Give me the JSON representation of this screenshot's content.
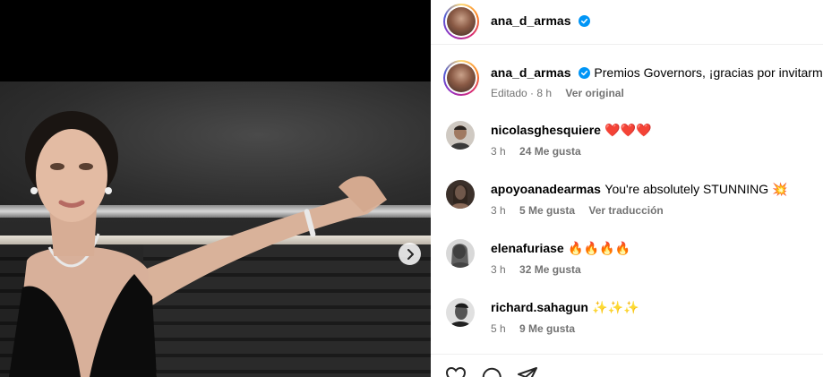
{
  "post": {
    "author": "ana_d_armas",
    "caption": "Premios Governors, ¡gracias por invitarme! ✨",
    "edited_label": "Editado",
    "age": "8 h",
    "translate_label": "Ver original"
  },
  "comments": [
    {
      "user": "nicolasghesquiere",
      "text": "❤️❤️❤️",
      "age": "3 h",
      "likes": "24 Me gusta",
      "extra": ""
    },
    {
      "user": "apoyoanadearmas",
      "text": "You're absolutely STUNNING 💥",
      "age": "3 h",
      "likes": "5 Me gusta",
      "extra": "Ver traducción"
    },
    {
      "user": "elenafuriase",
      "text": "🔥🔥🔥🔥",
      "age": "3 h",
      "likes": "32 Me gusta",
      "extra": ""
    },
    {
      "user": "richard.sahagun",
      "text": "✨✨✨",
      "age": "5 h",
      "likes": "9 Me gusta",
      "extra": ""
    }
  ],
  "icons": {
    "verified": "verified-badge-icon",
    "next": "chevron-right-icon",
    "like": "heart-icon",
    "comment": "comment-icon",
    "share": "share-icon"
  },
  "colors": {
    "verified": "#0095f6",
    "meta": "#737373",
    "heart": "#ed2c3e"
  }
}
